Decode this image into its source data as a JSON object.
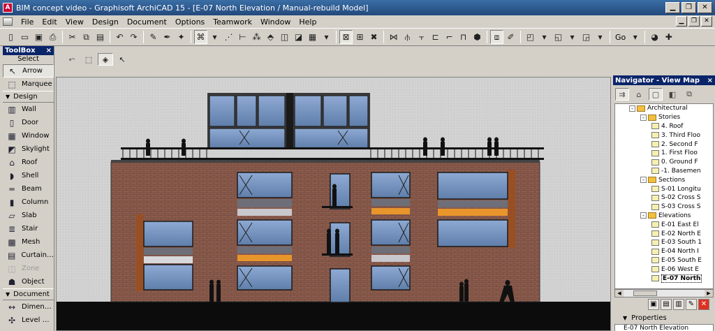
{
  "window": {
    "title": "BIM concept video - Graphisoft ArchiCAD 15 - [E-07 North Elevation / Manual-rebuild Model]",
    "minimize_icon": "minimize-icon",
    "maximize_icon": "maximize-icon",
    "close_icon": "close-icon"
  },
  "menu": {
    "items": [
      "File",
      "Edit",
      "View",
      "Design",
      "Document",
      "Options",
      "Teamwork",
      "Window",
      "Help"
    ]
  },
  "toolbar": {
    "go_label": "Go"
  },
  "toolbox": {
    "title": "ToolBox",
    "close": "×",
    "select_label": "Select",
    "select_tools": [
      {
        "label": "Arrow",
        "icon": "arrow-icon",
        "glyph": "↖"
      },
      {
        "label": "Marquee",
        "icon": "marquee-icon",
        "glyph": "⬚"
      }
    ],
    "design_label": "Design",
    "design_tools": [
      {
        "label": "Wall",
        "icon": "wall-icon",
        "glyph": "▥"
      },
      {
        "label": "Door",
        "icon": "door-icon",
        "glyph": "▯"
      },
      {
        "label": "Window",
        "icon": "window-icon",
        "glyph": "▦"
      },
      {
        "label": "Skylight",
        "icon": "skylight-icon",
        "glyph": "◩"
      },
      {
        "label": "Roof",
        "icon": "roof-icon",
        "glyph": "⌂"
      },
      {
        "label": "Shell",
        "icon": "shell-icon",
        "glyph": "◗"
      },
      {
        "label": "Beam",
        "icon": "beam-icon",
        "glyph": "═"
      },
      {
        "label": "Column",
        "icon": "column-icon",
        "glyph": "▮"
      },
      {
        "label": "Slab",
        "icon": "slab-icon",
        "glyph": "▱"
      },
      {
        "label": "Stair",
        "icon": "stair-icon",
        "glyph": "≣"
      },
      {
        "label": "Mesh",
        "icon": "mesh-icon",
        "glyph": "▩"
      },
      {
        "label": "Curtain…",
        "icon": "curtain-wall-icon",
        "glyph": "▤"
      },
      {
        "label": "Zone",
        "icon": "zone-icon",
        "glyph": "◫"
      },
      {
        "label": "Object",
        "icon": "object-icon",
        "glyph": "☗"
      }
    ],
    "document_label": "Document",
    "document_tools": [
      {
        "label": "Dimen…",
        "icon": "dimension-icon",
        "glyph": "↔"
      },
      {
        "label": "Level …",
        "icon": "level-dimension-icon",
        "glyph": "✣"
      }
    ]
  },
  "navigator": {
    "title": "Navigator - View Map",
    "close": "×",
    "tree": [
      {
        "label": "Architectural",
        "level": 0,
        "kind": "folder",
        "exp": "-"
      },
      {
        "label": "Stories",
        "level": 1,
        "kind": "folder",
        "exp": "-"
      },
      {
        "label": "4. Roof",
        "level": 2,
        "kind": "view"
      },
      {
        "label": "3. Third Floo",
        "level": 2,
        "kind": "view"
      },
      {
        "label": "2. Second F",
        "level": 2,
        "kind": "view"
      },
      {
        "label": "1. First Floo",
        "level": 2,
        "kind": "view"
      },
      {
        "label": "0. Ground F",
        "level": 2,
        "kind": "view"
      },
      {
        "label": "-1. Basemen",
        "level": 2,
        "kind": "view"
      },
      {
        "label": "Sections",
        "level": 1,
        "kind": "folder",
        "exp": "-"
      },
      {
        "label": "S-01 Longitu",
        "level": 2,
        "kind": "view"
      },
      {
        "label": "S-02 Cross S",
        "level": 2,
        "kind": "view"
      },
      {
        "label": "S-03 Cross S",
        "level": 2,
        "kind": "view"
      },
      {
        "label": "Elevations",
        "level": 1,
        "kind": "folder",
        "exp": "-"
      },
      {
        "label": "E-01 East El",
        "level": 2,
        "kind": "view"
      },
      {
        "label": "E-02 North E",
        "level": 2,
        "kind": "view"
      },
      {
        "label": "E-03 South 1",
        "level": 2,
        "kind": "view"
      },
      {
        "label": "E-04 North I",
        "level": 2,
        "kind": "view"
      },
      {
        "label": "E-05 South E",
        "level": 2,
        "kind": "view"
      },
      {
        "label": "E-06 West E",
        "level": 2,
        "kind": "view"
      },
      {
        "label": "E-07 North",
        "level": 2,
        "kind": "view",
        "selected": true
      }
    ],
    "properties_label": "Properties",
    "properties_value": "E-07   North Elevation"
  },
  "colors": {
    "accent": "#0a246a",
    "brick": "#8a5a4c",
    "glass": "#6f8fb8",
    "facade_orange": "#e8952c",
    "ground": "#0c0c0c",
    "sky": "#d0d0d0"
  }
}
